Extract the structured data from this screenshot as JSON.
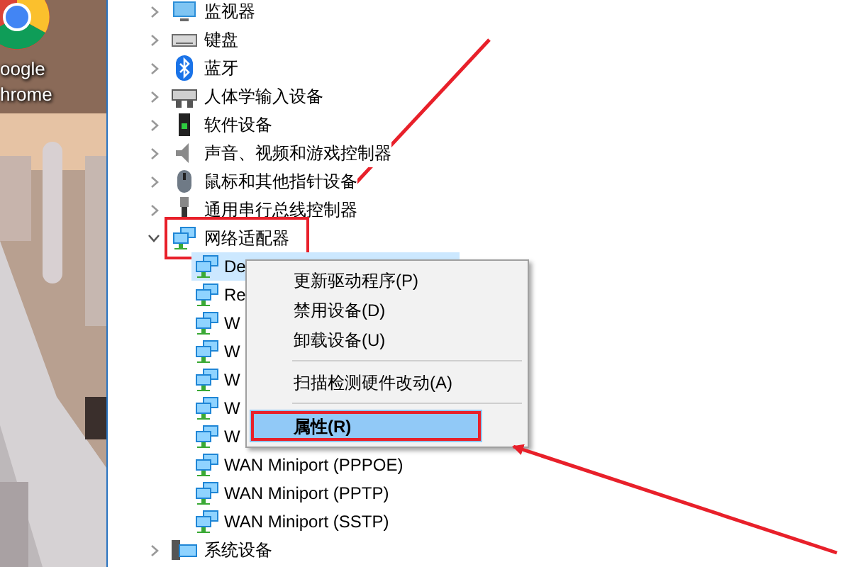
{
  "desktop": {
    "icon_label_lines": [
      "oogle",
      "hrome"
    ]
  },
  "device_tree": [
    {
      "label": "监视器",
      "kind": "monitor",
      "expanded": false,
      "highlighted": false
    },
    {
      "label": "键盘",
      "kind": "keyboard",
      "expanded": false,
      "highlighted": false
    },
    {
      "label": "蓝牙",
      "kind": "bluetooth",
      "expanded": false,
      "highlighted": false
    },
    {
      "label": "人体学输入设备",
      "kind": "hid",
      "expanded": false,
      "highlighted": false
    },
    {
      "label": "软件设备",
      "kind": "software",
      "expanded": false,
      "highlighted": false
    },
    {
      "label": "声音、视频和游戏控制器",
      "kind": "sound",
      "expanded": false,
      "highlighted": false
    },
    {
      "label": "鼠标和其他指针设备",
      "kind": "mouse",
      "expanded": false,
      "highlighted": false
    },
    {
      "label": "通用串行总线控制器",
      "kind": "usb",
      "expanded": false,
      "highlighted": false
    },
    {
      "label": "网络适配器",
      "kind": "network",
      "expanded": true,
      "highlighted": true,
      "children": [
        {
          "label": "De",
          "selected": true
        },
        {
          "label": "Re",
          "selected": false
        },
        {
          "label": "W",
          "selected": false
        },
        {
          "label": "W",
          "selected": false
        },
        {
          "label": "W",
          "selected": false
        },
        {
          "label": "W",
          "selected": false
        },
        {
          "label": "W",
          "selected": false
        },
        {
          "label": "WAN Miniport (PPPOE)",
          "selected": false
        },
        {
          "label": "WAN Miniport (PPTP)",
          "selected": false
        },
        {
          "label": "WAN Miniport (SSTP)",
          "selected": false
        }
      ]
    },
    {
      "label": "系统设备",
      "kind": "system",
      "expanded": false,
      "highlighted": false
    }
  ],
  "context_menu": [
    {
      "kind": "item",
      "label": "更新驱动程序(P)",
      "selected": false,
      "highlighted": false
    },
    {
      "kind": "item",
      "label": "禁用设备(D)",
      "selected": false,
      "highlighted": false
    },
    {
      "kind": "item",
      "label": "卸载设备(U)",
      "selected": false,
      "highlighted": false
    },
    {
      "kind": "separator"
    },
    {
      "kind": "item",
      "label": "扫描检测硬件改动(A)",
      "selected": false,
      "highlighted": false
    },
    {
      "kind": "separator"
    },
    {
      "kind": "default",
      "label": "属性(R)",
      "selected": true,
      "highlighted": true
    }
  ]
}
